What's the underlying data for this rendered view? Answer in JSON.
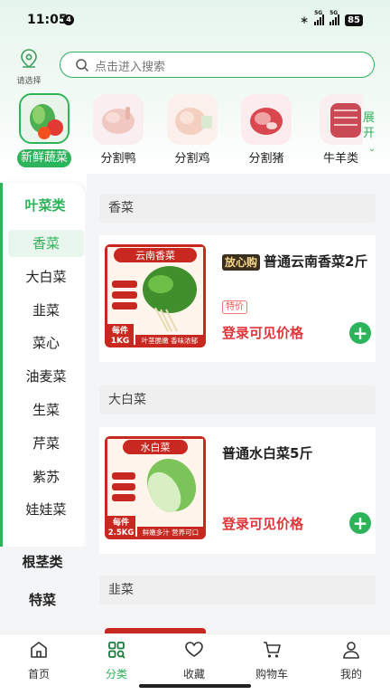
{
  "status_bar": {
    "time": "11:05",
    "notification_badge": "4",
    "signal_tag_1": "5G",
    "signal_tag_2": "5G",
    "battery": "85",
    "icons": [
      "bluetooth-icon",
      "signal-icon",
      "signal-icon",
      "battery-icon"
    ]
  },
  "header": {
    "location_label": "请选择",
    "search_placeholder": "点击进入搜索"
  },
  "categories": [
    {
      "label": "新鲜蔬菜",
      "active": true
    },
    {
      "label": "分割鸭",
      "active": false
    },
    {
      "label": "分割鸡",
      "active": false
    },
    {
      "label": "分割猪",
      "active": false
    },
    {
      "label": "牛羊类",
      "active": false
    }
  ],
  "expand_label": "展开",
  "sidebar": {
    "active_group": "叶菜类",
    "items": [
      "香菜",
      "大白菜",
      "韭菜",
      "菜心",
      "油麦菜",
      "生菜",
      "芹菜",
      "紫苏",
      "娃娃菜"
    ],
    "active_item": "香菜",
    "other_groups": [
      "根茎类",
      "特菜"
    ]
  },
  "sections": [
    {
      "title": "香菜",
      "product": {
        "badge": "放心购",
        "name": "普通云南香菜2斤",
        "tag": "特价",
        "price_text": "登录可见价格",
        "image_title": "云南香菜",
        "image_unit_top": "每件",
        "image_unit_bottom": "1KG",
        "image_slogan": "叶茎脆嫩 香味浓郁"
      }
    },
    {
      "title": "大白菜",
      "product": {
        "name": "普通水白菜5斤",
        "price_text": "登录可见价格",
        "image_title": "水白菜",
        "image_unit_top": "每件",
        "image_unit_bottom": "2.5KG",
        "image_slogan": "鲜嫩多汁 营养可口"
      }
    },
    {
      "title": "韭菜"
    }
  ],
  "tabbar": [
    {
      "label": "首页",
      "icon": "home-icon",
      "active": false
    },
    {
      "label": "分类",
      "icon": "category-icon",
      "active": true
    },
    {
      "label": "收藏",
      "icon": "heart-icon",
      "active": false
    },
    {
      "label": "购物车",
      "icon": "cart-icon",
      "active": false
    },
    {
      "label": "我的",
      "icon": "user-icon",
      "active": false
    }
  ],
  "colors": {
    "brand_green": "#2db35a",
    "price_red": "#e0353a",
    "badge_dark": "#3a2f1e"
  }
}
